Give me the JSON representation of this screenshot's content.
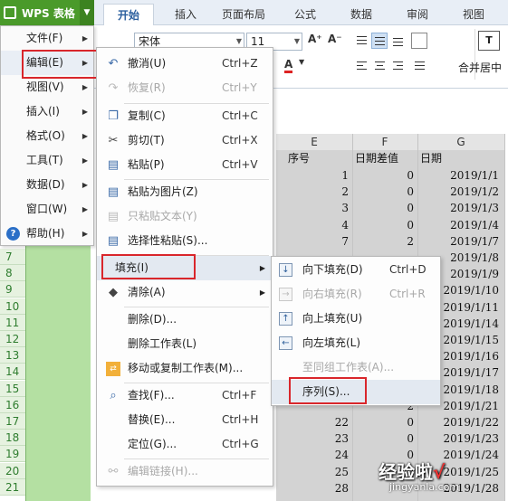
{
  "app": {
    "title": "WPS 表格"
  },
  "tabs": [
    "开始",
    "插入",
    "页面布局",
    "公式",
    "数据",
    "审阅",
    "视图"
  ],
  "ribbon": {
    "font_name": "宋体",
    "font_size": "11",
    "merge_center": "合并居中"
  },
  "sheet": {
    "col_headers": [
      "E",
      "F",
      "G"
    ],
    "headers": [
      "序号",
      "日期差值",
      "日期"
    ],
    "rows": [
      {
        "seq": "1",
        "diff": "0",
        "date": "2019/1/1"
      },
      {
        "seq": "2",
        "diff": "0",
        "date": "2019/1/2"
      },
      {
        "seq": "3",
        "diff": "0",
        "date": "2019/1/3"
      },
      {
        "seq": "4",
        "diff": "0",
        "date": "2019/1/4"
      },
      {
        "seq": "7",
        "diff": "2",
        "date": "2019/1/7"
      },
      {
        "seq": "",
        "diff": "",
        "date": "2019/1/8"
      },
      {
        "seq": "",
        "diff": "",
        "date": "2019/1/9"
      },
      {
        "seq": "",
        "diff": "",
        "date": "2019/1/10"
      },
      {
        "seq": "",
        "diff": "",
        "date": "2019/1/11"
      },
      {
        "seq": "",
        "diff": "",
        "date": "2019/1/14"
      },
      {
        "seq": "",
        "diff": "",
        "date": "2019/1/15"
      },
      {
        "seq": "",
        "diff": "",
        "date": "2019/1/16"
      },
      {
        "seq": "",
        "diff": "",
        "date": "2019/1/17"
      },
      {
        "seq": "",
        "diff": "",
        "date": "2019/1/18"
      },
      {
        "seq": "",
        "diff": "2",
        "date": "2019/1/21"
      },
      {
        "seq": "22",
        "diff": "0",
        "date": "2019/1/22"
      },
      {
        "seq": "23",
        "diff": "0",
        "date": "2019/1/23"
      },
      {
        "seq": "24",
        "diff": "0",
        "date": "2019/1/24"
      },
      {
        "seq": "25",
        "diff": "0",
        "date": "2019/1/25"
      },
      {
        "seq": "28",
        "diff": "",
        "date": "2019/1/28"
      }
    ],
    "row_numbers": [
      "7",
      "8",
      "9",
      "10",
      "11",
      "12",
      "13",
      "14",
      "15",
      "16",
      "17",
      "18",
      "19",
      "20",
      "21"
    ]
  },
  "main_menu": [
    {
      "label": "文件(F)"
    },
    {
      "label": "编辑(E)"
    },
    {
      "label": "视图(V)"
    },
    {
      "label": "插入(I)"
    },
    {
      "label": "格式(O)"
    },
    {
      "label": "工具(T)"
    },
    {
      "label": "数据(D)"
    },
    {
      "label": "窗口(W)"
    },
    {
      "label": "帮助(H)"
    }
  ],
  "edit_menu": [
    {
      "label": "撤消(U)",
      "shortcut": "Ctrl+Z",
      "icon": "undo-icon"
    },
    {
      "label": "恢复(R)",
      "shortcut": "Ctrl+Y",
      "icon": "redo-icon"
    },
    {
      "label": "复制(C)",
      "shortcut": "Ctrl+C",
      "icon": "copy-icon"
    },
    {
      "label": "剪切(T)",
      "shortcut": "Ctrl+X",
      "icon": "cut-icon"
    },
    {
      "label": "粘贴(P)",
      "shortcut": "Ctrl+V",
      "icon": "paste-icon"
    },
    {
      "label": "粘贴为图片(Z)",
      "shortcut": "",
      "icon": "paste-picture-icon"
    },
    {
      "label": "只粘贴文本(Y)",
      "shortcut": "",
      "icon": "paste-text-icon"
    },
    {
      "label": "选择性粘贴(S)...",
      "shortcut": "",
      "icon": "paste-special-icon"
    },
    {
      "label": "填充(I)",
      "shortcut": "",
      "icon": ""
    },
    {
      "label": "清除(A)",
      "shortcut": "",
      "icon": "eraser-icon"
    },
    {
      "label": "删除(D)...",
      "shortcut": "",
      "icon": ""
    },
    {
      "label": "删除工作表(L)",
      "shortcut": "",
      "icon": ""
    },
    {
      "label": "移动或复制工作表(M)...",
      "shortcut": "",
      "icon": "move-sheet-icon"
    },
    {
      "label": "查找(F)...",
      "shortcut": "Ctrl+F",
      "icon": "find-icon"
    },
    {
      "label": "替换(E)...",
      "shortcut": "Ctrl+H",
      "icon": ""
    },
    {
      "label": "定位(G)...",
      "shortcut": "Ctrl+G",
      "icon": ""
    },
    {
      "label": "编辑链接(H)...",
      "shortcut": "",
      "icon": "link-icon"
    }
  ],
  "fill_menu": [
    {
      "label": "向下填充(D)",
      "shortcut": "Ctrl+D",
      "icon": "fill-down-icon"
    },
    {
      "label": "向右填充(R)",
      "shortcut": "Ctrl+R",
      "icon": "fill-right-icon"
    },
    {
      "label": "向上填充(U)",
      "shortcut": "",
      "icon": "fill-up-icon"
    },
    {
      "label": "向左填充(L)",
      "shortcut": "",
      "icon": "fill-left-icon"
    },
    {
      "label": "至同组工作表(A)...",
      "shortcut": "",
      "icon": ""
    },
    {
      "label": "序列(S)...",
      "shortcut": "",
      "icon": ""
    }
  ],
  "watermark": {
    "text": "经验啦",
    "check": "√",
    "url": "jingyanla.com"
  },
  "colors": {
    "wps_green": "#4a9a2a",
    "highlight_red": "#d9262b",
    "sheet_gray": "#d3d3d3",
    "selected_green": "#b4e0a2"
  }
}
